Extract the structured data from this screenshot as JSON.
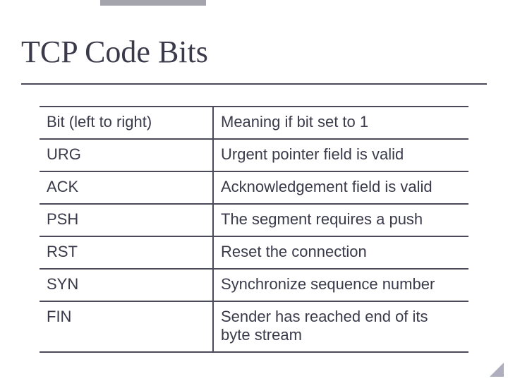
{
  "title": "TCP Code Bits",
  "table": {
    "headers": {
      "col1": "Bit (left to right)",
      "col2": "Meaning if bit set to 1"
    },
    "rows": [
      {
        "bit": "URG",
        "meaning": "Urgent pointer field is valid"
      },
      {
        "bit": "ACK",
        "meaning": "Acknowledgement field is valid"
      },
      {
        "bit": "PSH",
        "meaning": "The segment requires a push"
      },
      {
        "bit": "RST",
        "meaning": "Reset the connection"
      },
      {
        "bit": "SYN",
        "meaning": "Synchronize sequence number"
      },
      {
        "bit": "FIN",
        "meaning": "Sender has reached end of its byte stream"
      }
    ]
  }
}
